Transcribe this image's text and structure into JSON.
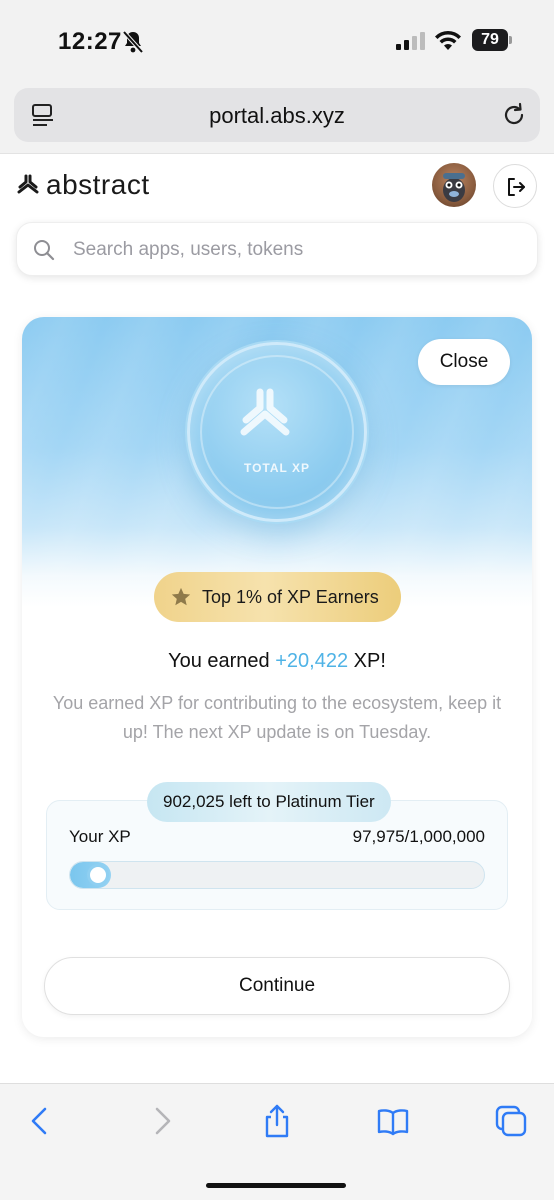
{
  "status_bar": {
    "time": "12:27",
    "battery": "79"
  },
  "browser": {
    "url": "portal.abs.xyz"
  },
  "header": {
    "brand": "abstract"
  },
  "search": {
    "placeholder": "Search apps, users, tokens"
  },
  "modal": {
    "close_label": "Close",
    "coin_label": "TOTAL XP",
    "rank_badge": "Top 1% of XP Earners",
    "earned_prefix": "You earned ",
    "earned_amount": "+20,422",
    "earned_suffix": " XP!",
    "description": "You earned XP for contributing to the ecosystem, keep it up! The next XP update is on Tuesday.",
    "tier_pill": "902,025 left to Platinum Tier",
    "xp_label": "Your XP",
    "xp_value": "97,975/1,000,000",
    "xp_progress_fraction": 0.098,
    "continue_label": "Continue"
  },
  "colors": {
    "accent_blue": "#4fb3e6",
    "gold": "#f0d38b",
    "ios_blue": "#2f7bf6"
  }
}
